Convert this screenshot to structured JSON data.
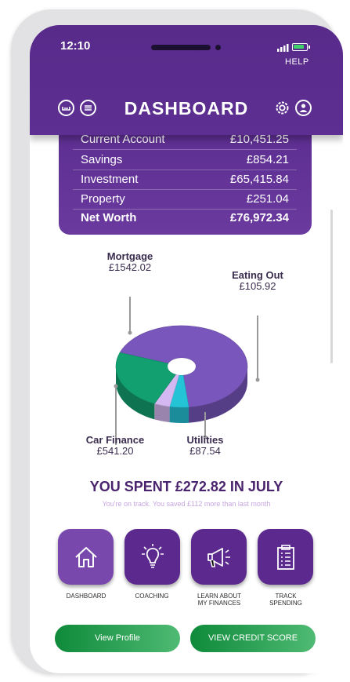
{
  "status": {
    "time": "12:10",
    "help": "HELP"
  },
  "header": {
    "title": "DASHBOARD"
  },
  "accounts": [
    {
      "label": "Current Account",
      "value": "£10,451.25"
    },
    {
      "label": "Savings",
      "value": "£854.21"
    },
    {
      "label": "Investment",
      "value": "£65,415.84"
    },
    {
      "label": "Property",
      "value": "£251.04"
    }
  ],
  "net_worth": {
    "label": "Net Worth",
    "value": "£76,972.34"
  },
  "chart_data": {
    "type": "pie",
    "labels": [
      "Mortgage",
      "Eating Out",
      "Utilities",
      "Car Finance"
    ],
    "values": [
      1542.02,
      105.92,
      87.54,
      541.2
    ],
    "value_labels": [
      "£1542.02",
      "£105.92",
      "£87.54",
      "£541.20"
    ],
    "colors": [
      "#7856bb",
      "#25c3d6",
      "#d4b8f2",
      "#12a071"
    ]
  },
  "summary": {
    "headline": "YOU SPENT £272.82 IN JULY",
    "subtext": "You're on track. You saved £112 more than last month"
  },
  "tiles": [
    {
      "label": "DASHBOARD",
      "icon": "home-icon",
      "active": true
    },
    {
      "label": "COACHING",
      "icon": "lightbulb-icon",
      "active": false
    },
    {
      "label": "LEARN ABOUT\nMY FINANCES",
      "icon": "megaphone-icon",
      "active": false
    },
    {
      "label": "TRACK\nSPENDING",
      "icon": "clipboard-icon",
      "active": false
    }
  ],
  "buttons": {
    "profile": "View Profile",
    "credit": "VIEW CREDIT SCORE"
  },
  "colors": {
    "brand": "#5c2a8e",
    "accent_green": "#0e8a3a"
  }
}
